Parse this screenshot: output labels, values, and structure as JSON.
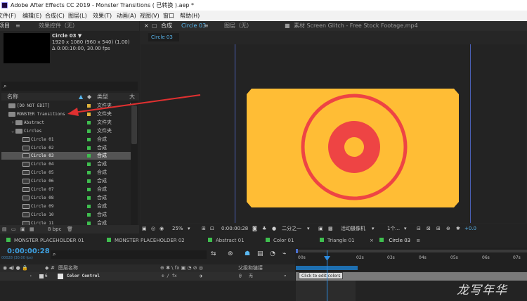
{
  "window": {
    "title": "Adobe After Effects CC 2019 - Monster Transitions ( 已转换 ).aep *"
  },
  "menu": [
    "文件(F)",
    "编辑(E)",
    "合成(C)",
    "图层(L)",
    "效果(T)",
    "动画(A)",
    "视图(V)",
    "窗口",
    "帮助(H)"
  ],
  "project_panel": {
    "tab_project": "项目",
    "tab_effects": "效果控件（无）",
    "comp_name": "Circle 03 ▼",
    "comp_res": "1920 x 1080 (960 x 540) (1.00)",
    "comp_dur": "Δ 0:00:10:00, 30.00 fps",
    "search_icon": "⌕",
    "col_name": "名称",
    "col_type": "类型",
    "col_size": "大小",
    "bpc": "8 bpc",
    "items": [
      {
        "name": "[DO NOT EDIT]",
        "type": "文件夹",
        "kind": "folder",
        "label_color": "#e0b43c",
        "indent": 0,
        "selected": false
      },
      {
        "name": "MONSTER Transitions",
        "type": "文件夹",
        "kind": "folder",
        "label_color": "#e0b43c",
        "indent": 0,
        "selected": false
      },
      {
        "name": "Abstract",
        "type": "文件夹",
        "kind": "folder",
        "label_color": "#3fbf4f",
        "indent": 1,
        "selected": false
      },
      {
        "name": "Circles",
        "type": "文件夹",
        "kind": "folder",
        "label_color": "#3fbf4f",
        "indent": 1,
        "selected": false
      },
      {
        "name": "Circle 01",
        "type": "合成",
        "kind": "comp",
        "label_color": "#3fbf4f",
        "indent": 2,
        "selected": false
      },
      {
        "name": "Circle 02",
        "type": "合成",
        "kind": "comp",
        "label_color": "#3fbf4f",
        "indent": 2,
        "selected": false
      },
      {
        "name": "Circle 03",
        "type": "合成",
        "kind": "comp",
        "label_color": "#3fbf4f",
        "indent": 2,
        "selected": true
      },
      {
        "name": "Circle 04",
        "type": "合成",
        "kind": "comp",
        "label_color": "#3fbf4f",
        "indent": 2,
        "selected": false
      },
      {
        "name": "Circle 05",
        "type": "合成",
        "kind": "comp",
        "label_color": "#3fbf4f",
        "indent": 2,
        "selected": false
      },
      {
        "name": "Circle 06",
        "type": "合成",
        "kind": "comp",
        "label_color": "#3fbf4f",
        "indent": 2,
        "selected": false
      },
      {
        "name": "Circle 07",
        "type": "合成",
        "kind": "comp",
        "label_color": "#3fbf4f",
        "indent": 2,
        "selected": false
      },
      {
        "name": "Circle 08",
        "type": "合成",
        "kind": "comp",
        "label_color": "#3fbf4f",
        "indent": 2,
        "selected": false
      },
      {
        "name": "Circle 09",
        "type": "合成",
        "kind": "comp",
        "label_color": "#3fbf4f",
        "indent": 2,
        "selected": false
      },
      {
        "name": "Circle 10",
        "type": "合成",
        "kind": "comp",
        "label_color": "#3fbf4f",
        "indent": 2,
        "selected": false
      },
      {
        "name": "Circle 11",
        "type": "合成",
        "kind": "comp",
        "label_color": "#3fbf4f",
        "indent": 2,
        "selected": false
      }
    ]
  },
  "viewer": {
    "tab_comp": "合成",
    "tab_comp_name": "Circle 03",
    "tab_layer": "图层（无）",
    "tab_footage": "素材 Screen Glitch - Free Stock Footage.mp4",
    "subtab": "Circle 03",
    "zoom": "25%",
    "timecode": "0:00:00:28",
    "resolution": "二分之一",
    "camera": "活动摄像机",
    "views": "1个...",
    "exposure": "+0.0",
    "art_colors": {
      "card": "#ffbd35",
      "ring": "#ee4444"
    }
  },
  "timeline": {
    "tabs": [
      {
        "label": "MONSTER PLACEHOLDER 01",
        "color": "#3fbf4f"
      },
      {
        "label": "MONSTER PLACEHOLDER 02",
        "color": "#3fbf4f"
      },
      {
        "label": "Abstract 01",
        "color": "#3fbf4f"
      },
      {
        "label": "Color 01",
        "color": "#3fbf4f"
      },
      {
        "label": "Triangle 01",
        "color": "#3fbf4f"
      },
      {
        "label": "Circle 03",
        "color": "#3fbf4f",
        "active": true
      }
    ],
    "timecode": "0:00:00:28",
    "fps": "00028 (30.00 fps)",
    "col_layer_name": "图层名称",
    "col_parent": "父级和链接",
    "layer_index": "6",
    "layer_name": "Color Control",
    "parent_value": "无",
    "ruler_ticks": [
      "00s",
      "02s",
      "03s",
      "04s",
      "05s",
      "06s",
      "07s"
    ],
    "tooltip": "Click to edit colors",
    "watermark": "龙写年华"
  }
}
